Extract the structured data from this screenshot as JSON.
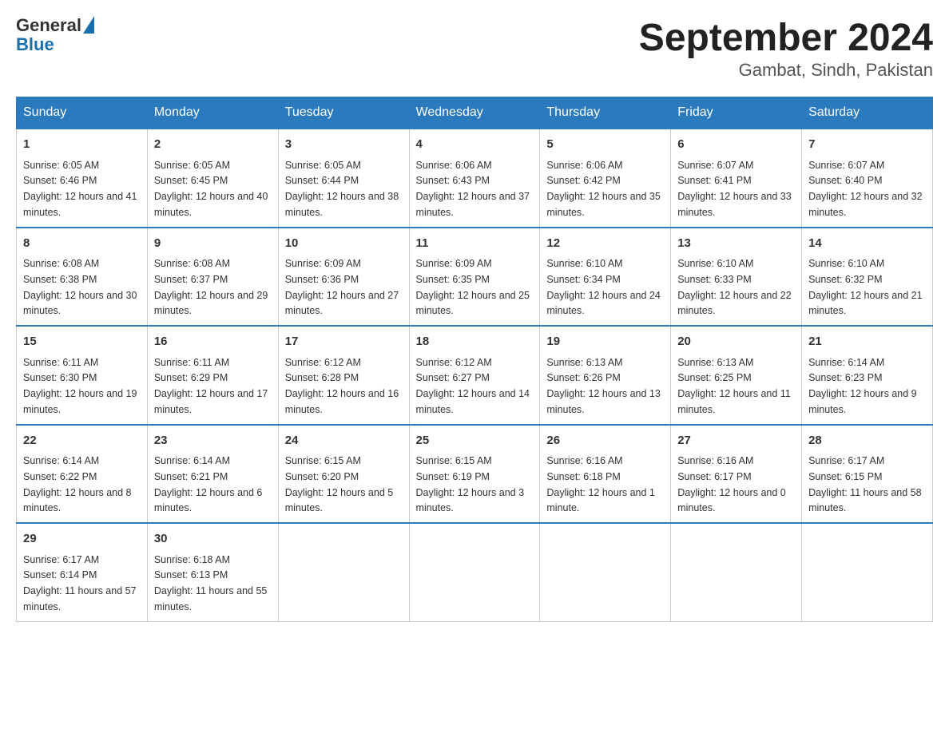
{
  "header": {
    "logo_general": "General",
    "logo_blue": "Blue",
    "month_title": "September 2024",
    "location": "Gambat, Sindh, Pakistan"
  },
  "weekdays": [
    "Sunday",
    "Monday",
    "Tuesday",
    "Wednesday",
    "Thursday",
    "Friday",
    "Saturday"
  ],
  "weeks": [
    [
      {
        "day": "1",
        "sunrise": "6:05 AM",
        "sunset": "6:46 PM",
        "daylight": "12 hours and 41 minutes."
      },
      {
        "day": "2",
        "sunrise": "6:05 AM",
        "sunset": "6:45 PM",
        "daylight": "12 hours and 40 minutes."
      },
      {
        "day": "3",
        "sunrise": "6:05 AM",
        "sunset": "6:44 PM",
        "daylight": "12 hours and 38 minutes."
      },
      {
        "day": "4",
        "sunrise": "6:06 AM",
        "sunset": "6:43 PM",
        "daylight": "12 hours and 37 minutes."
      },
      {
        "day": "5",
        "sunrise": "6:06 AM",
        "sunset": "6:42 PM",
        "daylight": "12 hours and 35 minutes."
      },
      {
        "day": "6",
        "sunrise": "6:07 AM",
        "sunset": "6:41 PM",
        "daylight": "12 hours and 33 minutes."
      },
      {
        "day": "7",
        "sunrise": "6:07 AM",
        "sunset": "6:40 PM",
        "daylight": "12 hours and 32 minutes."
      }
    ],
    [
      {
        "day": "8",
        "sunrise": "6:08 AM",
        "sunset": "6:38 PM",
        "daylight": "12 hours and 30 minutes."
      },
      {
        "day": "9",
        "sunrise": "6:08 AM",
        "sunset": "6:37 PM",
        "daylight": "12 hours and 29 minutes."
      },
      {
        "day": "10",
        "sunrise": "6:09 AM",
        "sunset": "6:36 PM",
        "daylight": "12 hours and 27 minutes."
      },
      {
        "day": "11",
        "sunrise": "6:09 AM",
        "sunset": "6:35 PM",
        "daylight": "12 hours and 25 minutes."
      },
      {
        "day": "12",
        "sunrise": "6:10 AM",
        "sunset": "6:34 PM",
        "daylight": "12 hours and 24 minutes."
      },
      {
        "day": "13",
        "sunrise": "6:10 AM",
        "sunset": "6:33 PM",
        "daylight": "12 hours and 22 minutes."
      },
      {
        "day": "14",
        "sunrise": "6:10 AM",
        "sunset": "6:32 PM",
        "daylight": "12 hours and 21 minutes."
      }
    ],
    [
      {
        "day": "15",
        "sunrise": "6:11 AM",
        "sunset": "6:30 PM",
        "daylight": "12 hours and 19 minutes."
      },
      {
        "day": "16",
        "sunrise": "6:11 AM",
        "sunset": "6:29 PM",
        "daylight": "12 hours and 17 minutes."
      },
      {
        "day": "17",
        "sunrise": "6:12 AM",
        "sunset": "6:28 PM",
        "daylight": "12 hours and 16 minutes."
      },
      {
        "day": "18",
        "sunrise": "6:12 AM",
        "sunset": "6:27 PM",
        "daylight": "12 hours and 14 minutes."
      },
      {
        "day": "19",
        "sunrise": "6:13 AM",
        "sunset": "6:26 PM",
        "daylight": "12 hours and 13 minutes."
      },
      {
        "day": "20",
        "sunrise": "6:13 AM",
        "sunset": "6:25 PM",
        "daylight": "12 hours and 11 minutes."
      },
      {
        "day": "21",
        "sunrise": "6:14 AM",
        "sunset": "6:23 PM",
        "daylight": "12 hours and 9 minutes."
      }
    ],
    [
      {
        "day": "22",
        "sunrise": "6:14 AM",
        "sunset": "6:22 PM",
        "daylight": "12 hours and 8 minutes."
      },
      {
        "day": "23",
        "sunrise": "6:14 AM",
        "sunset": "6:21 PM",
        "daylight": "12 hours and 6 minutes."
      },
      {
        "day": "24",
        "sunrise": "6:15 AM",
        "sunset": "6:20 PM",
        "daylight": "12 hours and 5 minutes."
      },
      {
        "day": "25",
        "sunrise": "6:15 AM",
        "sunset": "6:19 PM",
        "daylight": "12 hours and 3 minutes."
      },
      {
        "day": "26",
        "sunrise": "6:16 AM",
        "sunset": "6:18 PM",
        "daylight": "12 hours and 1 minute."
      },
      {
        "day": "27",
        "sunrise": "6:16 AM",
        "sunset": "6:17 PM",
        "daylight": "12 hours and 0 minutes."
      },
      {
        "day": "28",
        "sunrise": "6:17 AM",
        "sunset": "6:15 PM",
        "daylight": "11 hours and 58 minutes."
      }
    ],
    [
      {
        "day": "29",
        "sunrise": "6:17 AM",
        "sunset": "6:14 PM",
        "daylight": "11 hours and 57 minutes."
      },
      {
        "day": "30",
        "sunrise": "6:18 AM",
        "sunset": "6:13 PM",
        "daylight": "11 hours and 55 minutes."
      },
      null,
      null,
      null,
      null,
      null
    ]
  ]
}
